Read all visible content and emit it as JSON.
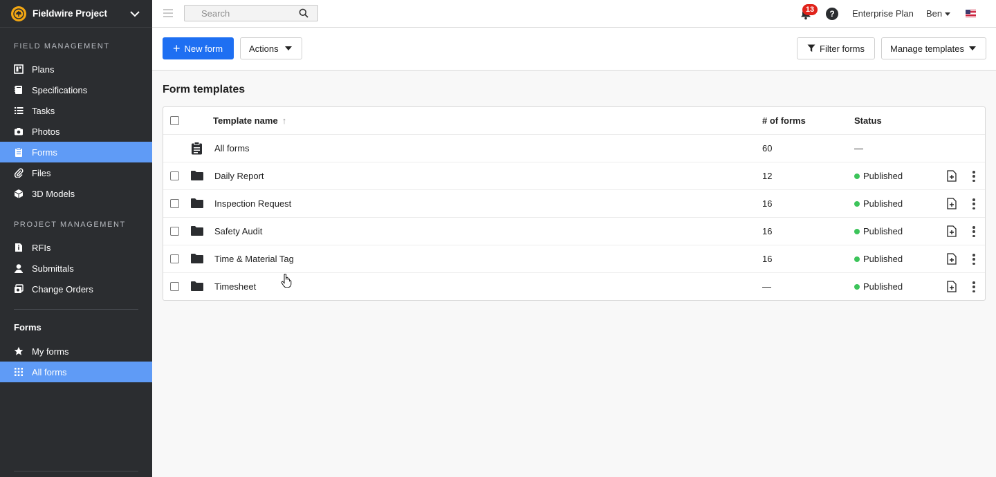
{
  "app": {
    "project_name": "Fieldwire Project"
  },
  "sidebar": {
    "field_management_title": "FIELD MANAGEMENT",
    "field_items": [
      {
        "label": "Plans",
        "icon": "plans-icon"
      },
      {
        "label": "Specifications",
        "icon": "specifications-icon"
      },
      {
        "label": "Tasks",
        "icon": "tasks-icon"
      },
      {
        "label": "Photos",
        "icon": "camera-icon"
      },
      {
        "label": "Forms",
        "icon": "clipboard-icon",
        "active": true
      },
      {
        "label": "Files",
        "icon": "paperclip-icon"
      },
      {
        "label": "3D Models",
        "icon": "cube-icon"
      }
    ],
    "project_management_title": "PROJECT MANAGEMENT",
    "project_items": [
      {
        "label": "RFIs",
        "icon": "rfi-icon"
      },
      {
        "label": "Submittals",
        "icon": "person-icon"
      },
      {
        "label": "Change Orders",
        "icon": "change-orders-icon"
      }
    ],
    "forms_heading": "Forms",
    "forms_items": [
      {
        "label": "My forms",
        "icon": "star-icon"
      },
      {
        "label": "All forms",
        "icon": "grid-icon",
        "active": true
      }
    ],
    "active_color": "#5f9bf6",
    "background_color": "#2b2d30"
  },
  "topbar": {
    "search_placeholder": "Search",
    "notification_count": "13",
    "help_label": "?",
    "plan_label": "Enterprise Plan",
    "user_name": "Ben"
  },
  "toolbar": {
    "new_form_label": "New form",
    "actions_label": "Actions",
    "filter_label": "Filter forms",
    "manage_templates_label": "Manage templates",
    "primary_color": "#1e6ff2"
  },
  "main": {
    "title": "Form templates",
    "columns": {
      "name": "Template name",
      "count": "# of forms",
      "status": "Status"
    },
    "all_forms_row": {
      "name": "All forms",
      "count": "60",
      "status": "—"
    },
    "rows": [
      {
        "name": "Daily Report",
        "count": "12",
        "status": "Published"
      },
      {
        "name": "Inspection Request",
        "count": "16",
        "status": "Published"
      },
      {
        "name": "Safety Audit",
        "count": "16",
        "status": "Published"
      },
      {
        "name": "Time & Material Tag",
        "count": "16",
        "status": "Published"
      },
      {
        "name": "Timesheet",
        "count": "—",
        "status": "Published"
      }
    ],
    "published_color": "#3cc45a"
  }
}
